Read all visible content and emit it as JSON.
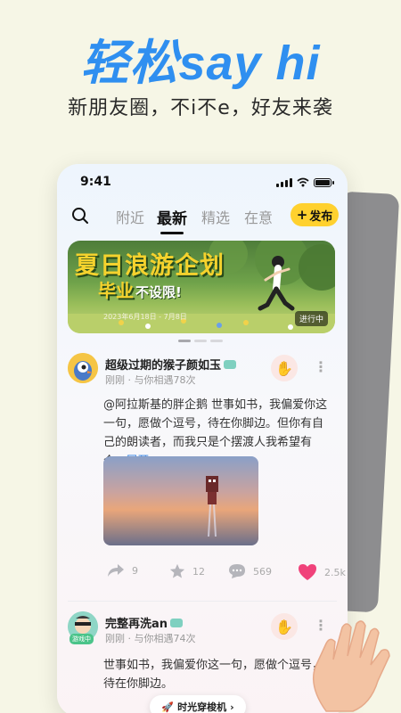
{
  "promo": {
    "headline": "轻松say hi",
    "subline": "新朋友圈，不i不e，好友来袭"
  },
  "status_bar": {
    "time": "9:41"
  },
  "tabs": [
    {
      "label": "附近",
      "active": false
    },
    {
      "label": "最新",
      "active": true
    },
    {
      "label": "精选",
      "active": false
    },
    {
      "label": "在意",
      "active": false
    }
  ],
  "post_button": {
    "icon": "plus-icon",
    "label": "发布"
  },
  "banner": {
    "title_line1": "夏日浪游企划",
    "title_line2": "毕业",
    "title_line2_suffix": "不设限!",
    "date": "2023年6月18日 - 7月8日",
    "status": "进行中"
  },
  "posts": [
    {
      "username": "超级过期的猴子颜如玉",
      "meta": "刚刚 · 与你相遇78次",
      "mention": "@阿拉斯基的胖企鹅",
      "text": " 世事如书，我偏爱你这一句，愿做个逗号，待在你脚边。但你有自己的朗读者，而我只是个摆渡人我希望有个...",
      "expand": "展开",
      "actions": {
        "share": "9",
        "like": "12",
        "comment": "569",
        "heart": "2.5k"
      }
    },
    {
      "username": "完整再洗an",
      "avatar_badge": "游戏中",
      "meta": "刚刚 · 与你相遇74次",
      "text": "世事如书，我偏爱你这一句，愿做个逗号，待在你脚边。"
    }
  ],
  "floating_button": {
    "label": "时光穿梭机",
    "icon": "rocket-icon"
  },
  "colors": {
    "accent_blue": "#2f8ff0",
    "yellow": "#ffd12f",
    "heart_pink": "#f0427a"
  }
}
